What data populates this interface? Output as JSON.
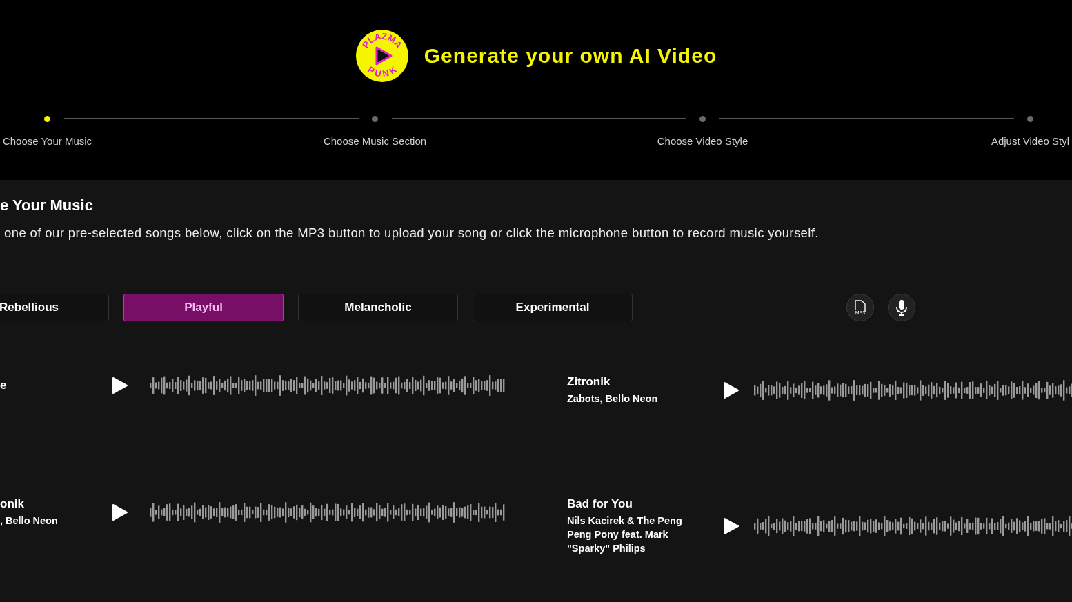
{
  "header": {
    "logo": {
      "top_text": "PLAZMA",
      "bottom_text": "PUNK"
    },
    "title": "Generate your own AI Video"
  },
  "steps": [
    {
      "label": "Choose Your Music",
      "selected": true
    },
    {
      "label": "Choose Music Section",
      "selected": false
    },
    {
      "label": "Choose Video Style",
      "selected": false
    },
    {
      "label": "Adjust Video Styl",
      "selected": false
    }
  ],
  "section": {
    "heading": "e Your Music",
    "description": "one of our pre-selected songs below, click on the MP3 button to upload your song or click the microphone button to record music yourself."
  },
  "moods": [
    {
      "label": "Rebellious",
      "selected": false
    },
    {
      "label": "Playful",
      "selected": true
    },
    {
      "label": "Melancholic",
      "selected": false
    },
    {
      "label": "Experimental",
      "selected": false
    }
  ],
  "upload_button": {
    "label": "MP3"
  },
  "songs": [
    {
      "title": "e"
    },
    {
      "title": "Zitronik",
      "artist": "Zabots, Bello Neon"
    },
    {
      "title": "onik",
      "artist": ", Bello Neon"
    },
    {
      "title": "Bad for You",
      "artist": "Nils Kacirek & The Peng Peng Pony feat. Mark \"Sparky\" Philips"
    }
  ]
}
